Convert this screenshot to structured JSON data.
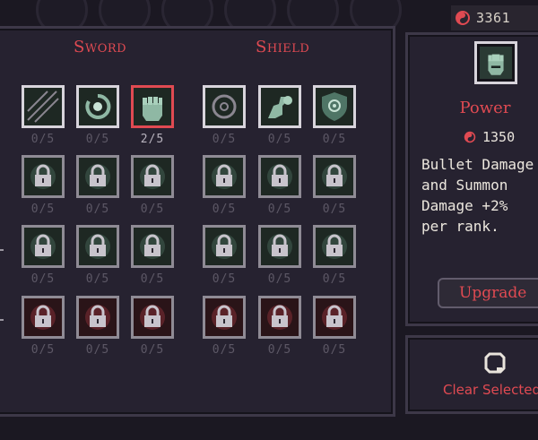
{
  "currency": {
    "icon": "soul-currency-icon",
    "amount": "3361"
  },
  "columns": {
    "sword_title": "Sword",
    "shield_title": "Shield"
  },
  "rows": [
    {
      "sword": [
        {
          "icon": "slash-icon",
          "rank": "0/5",
          "locked": false
        },
        {
          "icon": "vortex-icon",
          "rank": "0/5",
          "locked": false
        },
        {
          "icon": "fist-icon",
          "rank": "2/5",
          "locked": false,
          "selected": true
        }
      ],
      "shield": [
        {
          "icon": "ring-icon",
          "rank": "0/5",
          "locked": false
        },
        {
          "icon": "flex-arm-icon",
          "rank": "0/5",
          "locked": false
        },
        {
          "icon": "shield-eye-icon",
          "rank": "0/5",
          "locked": false
        }
      ]
    },
    {
      "sword": [
        {
          "icon": "padlock-icon",
          "rank": "0/5",
          "locked": true
        },
        {
          "icon": "padlock-icon",
          "rank": "0/5",
          "locked": true
        },
        {
          "icon": "padlock-icon",
          "rank": "0/5",
          "locked": true
        }
      ],
      "shield": [
        {
          "icon": "padlock-icon",
          "rank": "0/5",
          "locked": true
        },
        {
          "icon": "padlock-icon",
          "rank": "0/5",
          "locked": true
        },
        {
          "icon": "padlock-icon",
          "rank": "0/5",
          "locked": true
        }
      ]
    },
    {
      "sword": [
        {
          "icon": "padlock-icon",
          "rank": "0/5",
          "locked": true
        },
        {
          "icon": "padlock-icon",
          "rank": "0/5",
          "locked": true
        },
        {
          "icon": "padlock-icon",
          "rank": "0/5",
          "locked": true
        }
      ],
      "shield": [
        {
          "icon": "padlock-icon",
          "rank": "0/5",
          "locked": true
        },
        {
          "icon": "padlock-icon",
          "rank": "0/5",
          "locked": true
        },
        {
          "icon": "padlock-icon",
          "rank": "0/5",
          "locked": true
        }
      ]
    },
    {
      "sword": [
        {
          "icon": "padlock-icon",
          "rank": "0/5",
          "locked": true,
          "tint": "red"
        },
        {
          "icon": "padlock-icon",
          "rank": "0/5",
          "locked": true,
          "tint": "red"
        },
        {
          "icon": "padlock-icon",
          "rank": "0/5",
          "locked": true,
          "tint": "red"
        }
      ],
      "shield": [
        {
          "icon": "padlock-icon",
          "rank": "0/5",
          "locked": true,
          "tint": "red"
        },
        {
          "icon": "padlock-icon",
          "rank": "0/5",
          "locked": true,
          "tint": "red"
        },
        {
          "icon": "padlock-icon",
          "rank": "0/5",
          "locked": true,
          "tint": "red"
        }
      ]
    }
  ],
  "detail": {
    "icon": "fist-icon",
    "name": "Power",
    "cost": "1350",
    "description": "Bullet Damage\nand Summon\nDamage +2%\nper rank.",
    "upgrade_label": "Upgrade"
  },
  "clear": {
    "icon": "clear-icon",
    "label": "Clear Selected"
  },
  "colors": {
    "accent": "#e04a52",
    "panel": "#262230",
    "background": "#1b1822",
    "frame": "#d8d4dc"
  }
}
